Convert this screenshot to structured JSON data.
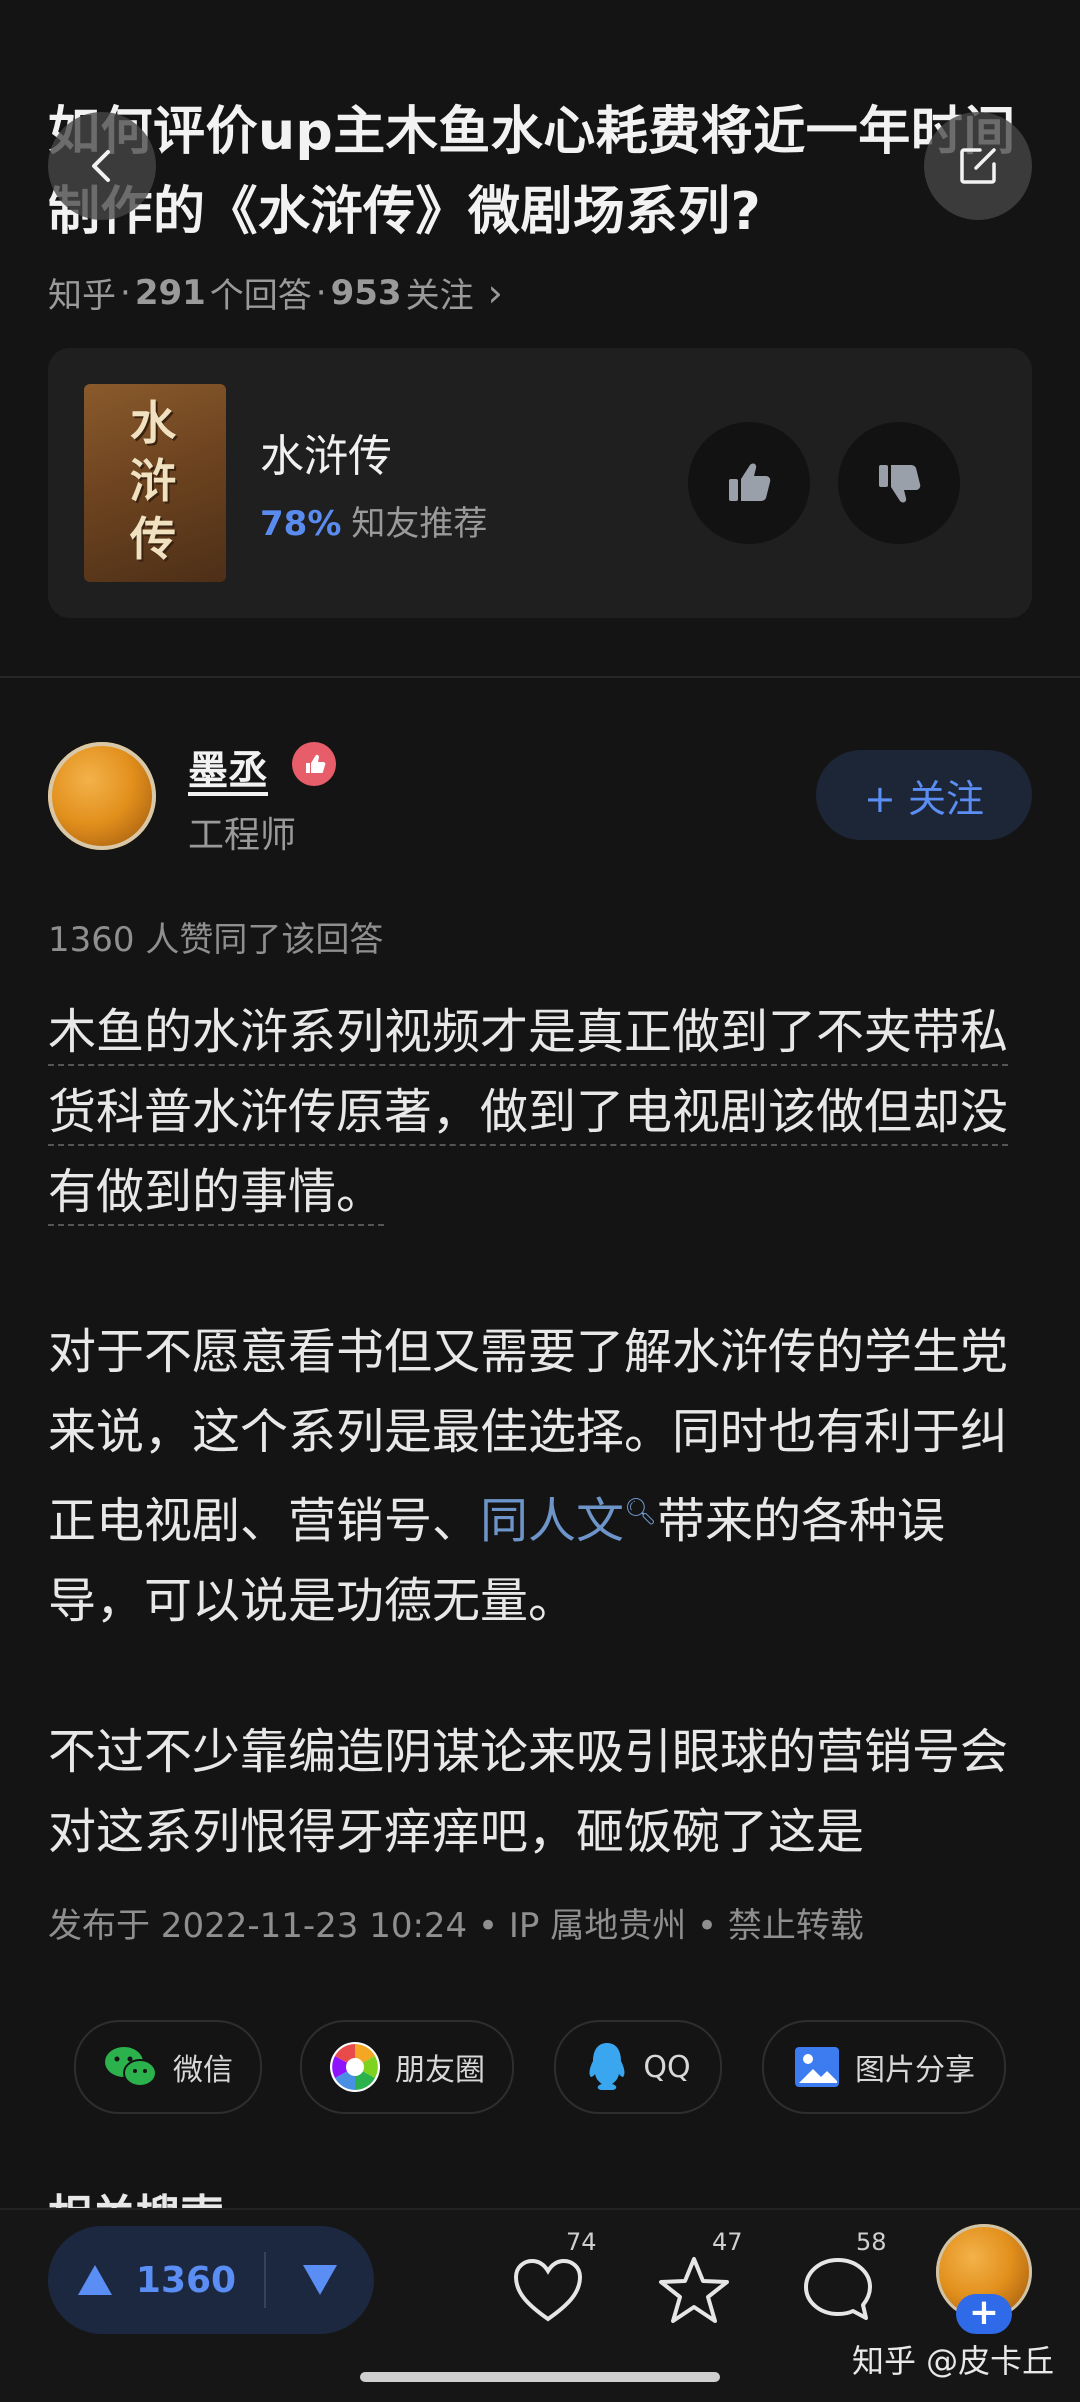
{
  "question": {
    "title": "如何评价up主木鱼水心耗费将近一年时间制作的《水浒传》微剧场系列?",
    "source": "知乎",
    "answers": "291",
    "answers_label": "个回答",
    "follows": "953",
    "follows_label": "关注",
    "dot": "·",
    "chevron": "›"
  },
  "book": {
    "cover_text": "水浒传",
    "name": "水浒传",
    "recommend_pct": "78%",
    "recommend_label": "知友推荐"
  },
  "author": {
    "name": "墨丞",
    "title": "工程师",
    "follow_label": "+ 关注"
  },
  "answer": {
    "agree_line": "1360 人赞同了该回答",
    "p1": "木鱼的水浒系列视频才是真正做到了不夹带私货科普水浒传原著，做到了电视剧该做但却没有做到的事情。",
    "p2_before": "对于不愿意看书但又需要了解水浒传的学生党来说，这个系列是最佳选择。同时也有利于纠正电视剧、营销号、",
    "p2_link": "同人文",
    "p2_after": "带来的各种误导，可以说是功德无量。",
    "p3": "不过不少靠编造阴谋论来吸引眼球的营销号会对这系列恨得牙痒痒吧，砸饭碗了这是",
    "publish": "发布于 2022-11-23 10:24 • IP 属地贵州 • 禁止转载"
  },
  "share": {
    "wechat": "微信",
    "moments": "朋友圈",
    "qq": "QQ",
    "image": "图片分享"
  },
  "related_heading": "相关搜索",
  "bottom": {
    "upvotes": "1360",
    "likes": "74",
    "favorites": "47",
    "comments": "58"
  },
  "watermark": "知乎 @皮卡丘",
  "colors": {
    "accent": "#5b8ef5",
    "background": "#141414",
    "card": "#1f1f1f",
    "link": "#6e95c9"
  },
  "icons": [
    "back-icon",
    "edit-icon",
    "thumb-up-icon",
    "thumb-down-icon",
    "badge-icon",
    "wechat-icon",
    "moments-icon",
    "qq-icon",
    "image-share-icon",
    "upvote-icon",
    "downvote-icon",
    "heart-icon",
    "star-icon",
    "comment-icon"
  ]
}
